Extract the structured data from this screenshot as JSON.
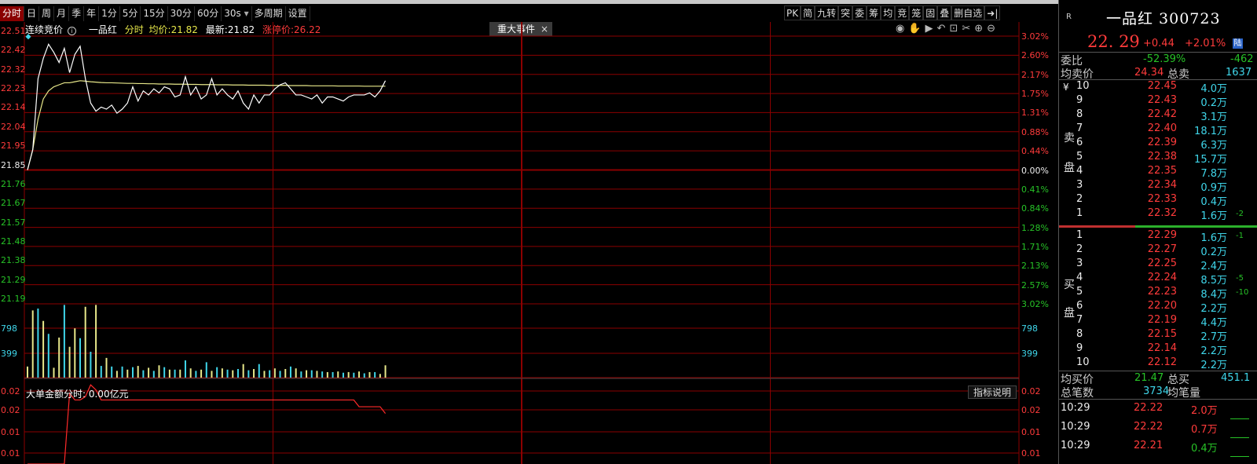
{
  "toolbar": {
    "tabs": [
      "分时",
      "日",
      "周",
      "月",
      "季",
      "年",
      "1分",
      "5分",
      "15分",
      "30分",
      "60分",
      "30s",
      "多周期",
      "设置"
    ],
    "right_tools": [
      "PK",
      "简",
      "九转",
      "突",
      "委",
      "筹",
      "均",
      "竞",
      "笼",
      "固",
      "叠",
      "删自选",
      "➜|"
    ]
  },
  "info": {
    "auction": "连续竞价",
    "name": "一品红",
    "mode": "分时",
    "avg_label": "均价:",
    "avg": "21.82",
    "latest_label": "最新:",
    "latest": "21.82",
    "limit_label": "涨停价:",
    "limit": "26.22",
    "event": "重大事件",
    "event_close": "×"
  },
  "colors": {
    "up": "#ff3b3b",
    "down": "#27c227",
    "grid": "#8b0000",
    "price_line": "#ffffff",
    "avg_line": "#e8e88a",
    "vol_up": "#e8e88a",
    "vol_down": "#3fd6ea",
    "big_order": "#ff2a2a"
  },
  "price_axis": {
    "left": [
      "22.51",
      "22.42",
      "22.32",
      "22.23",
      "22.14",
      "22.04",
      "21.95",
      "21.85",
      "21.76",
      "21.67",
      "21.57",
      "21.48",
      "21.38",
      "21.29",
      "21.19"
    ],
    "right": [
      "3.02%",
      "2.60%",
      "2.17%",
      "1.75%",
      "1.31%",
      "0.88%",
      "0.44%",
      "0.00%",
      "0.41%",
      "0.84%",
      "1.28%",
      "1.71%",
      "2.13%",
      "2.57%",
      "3.02%"
    ]
  },
  "volume_axis": {
    "left": [
      "798",
      "399"
    ],
    "right": [
      "798",
      "399"
    ]
  },
  "sub_chart": {
    "title": "大单金额分时: 0.00亿元",
    "button": "指标说明",
    "left": [
      "0.02",
      "0.02",
      "0.01",
      "0.01"
    ],
    "right": [
      "0.02",
      "0.02",
      "0.01",
      "0.01"
    ]
  },
  "chart_data": {
    "type": "line",
    "price_range": [
      21.19,
      22.51
    ],
    "prev_close": 21.85,
    "price": [
      21.85,
      21.95,
      22.3,
      22.4,
      22.47,
      22.43,
      22.38,
      22.45,
      22.33,
      22.42,
      22.46,
      22.3,
      22.18,
      22.14,
      22.16,
      22.15,
      22.17,
      22.13,
      22.15,
      22.18,
      22.26,
      22.19,
      22.24,
      22.22,
      22.25,
      22.23,
      22.26,
      22.25,
      22.21,
      22.22,
      22.31,
      22.22,
      22.26,
      22.2,
      22.22,
      22.3,
      22.22,
      22.25,
      22.22,
      22.2,
      22.24,
      22.18,
      22.15,
      22.22,
      22.18,
      22.22,
      22.22,
      22.25,
      22.27,
      22.28,
      22.25,
      22.22,
      22.22,
      22.21,
      22.2,
      22.22,
      22.18,
      22.21,
      22.21,
      22.2,
      22.19,
      22.21,
      22.22,
      22.22,
      22.22,
      22.23,
      22.21,
      22.24,
      22.29
    ],
    "avg_price": [
      21.85,
      21.95,
      22.1,
      22.2,
      22.24,
      22.26,
      22.27,
      22.28,
      22.28,
      22.285,
      22.29,
      22.288,
      22.285,
      22.283,
      22.281,
      22.28,
      22.28,
      22.279,
      22.278,
      22.277,
      22.277,
      22.276,
      22.276,
      22.275,
      22.275,
      22.274,
      22.274,
      22.274,
      22.273,
      22.273,
      22.273,
      22.272,
      22.272,
      22.271,
      22.271,
      22.271,
      22.27,
      22.27,
      22.27,
      22.269,
      22.269,
      22.269,
      22.268,
      22.268,
      22.268,
      22.268,
      22.267,
      22.267,
      22.267,
      22.267,
      22.266,
      22.266,
      22.266,
      22.266,
      22.265,
      22.265,
      22.265,
      22.265,
      22.265,
      22.264,
      22.264,
      22.264,
      22.264,
      22.264,
      22.263,
      22.263,
      22.263,
      22.263,
      22.263
    ],
    "volume_max": 1197,
    "volume": [
      180,
      1090,
      1120,
      920,
      710,
      160,
      650,
      1180,
      500,
      800,
      640,
      1150,
      420,
      1180,
      190,
      320,
      180,
      110,
      180,
      130,
      170,
      190,
      120,
      160,
      110,
      200,
      170,
      130,
      130,
      130,
      280,
      150,
      110,
      130,
      250,
      110,
      170,
      150,
      130,
      120,
      140,
      220,
      120,
      140,
      220,
      110,
      120,
      150,
      110,
      140,
      180,
      150,
      100,
      120,
      120,
      110,
      100,
      90,
      90,
      100,
      80,
      90,
      80,
      100,
      70,
      90,
      90,
      60,
      200
    ],
    "volume_color": [
      "y",
      "y",
      "c",
      "y",
      "c",
      "y",
      "y",
      "c",
      "y",
      "y",
      "c",
      "y",
      "c",
      "y",
      "c",
      "y",
      "c",
      "y",
      "c",
      "y",
      "c",
      "y",
      "c",
      "y",
      "c",
      "y",
      "c",
      "y",
      "c",
      "y",
      "c",
      "y",
      "c",
      "y",
      "c",
      "y",
      "c",
      "y",
      "c",
      "y",
      "c",
      "y",
      "c",
      "y",
      "c",
      "y",
      "c",
      "y",
      "c",
      "y",
      "c",
      "y",
      "c",
      "y",
      "c",
      "y",
      "c",
      "y",
      "c",
      "y",
      "c",
      "y",
      "c",
      "y",
      "c",
      "y",
      "c",
      "y",
      "y"
    ],
    "big_order_range": [
      0,
      0.024
    ],
    "big_order": [
      0,
      0,
      0,
      0,
      0,
      0,
      0,
      0.0,
      0.021,
      0.019,
      0.019,
      0.02,
      0.0235,
      0.022,
      0.019,
      0.019,
      0.019,
      0.019,
      0.019,
      0.019,
      0.019,
      0.019,
      0.019,
      0.019,
      0.019,
      0.019,
      0.019,
      0.019,
      0.019,
      0.019,
      0.019,
      0.019,
      0.019,
      0.019,
      0.019,
      0.019,
      0.019,
      0.019,
      0.019,
      0.019,
      0.019,
      0.019,
      0.019,
      0.019,
      0.019,
      0.019,
      0.019,
      0.019,
      0.019,
      0.019,
      0.019,
      0.019,
      0.019,
      0.019,
      0.019,
      0.019,
      0.019,
      0.019,
      0.019,
      0.019,
      0.019,
      0.019,
      0.019,
      0.017,
      0.017,
      0.017,
      0.017,
      0.017,
      0.015
    ]
  },
  "quote": {
    "badge": "R",
    "name": "一品红 300723",
    "price": "22. 29",
    "change": "+0.44",
    "pct": "+2.01%",
    "market": "陆",
    "weibi_label": "委比",
    "weibi": "-52.39%",
    "weicha": "-462",
    "avg_sell_label": "均卖价",
    "avg_sell": "24.34",
    "total_sell_label": "总卖",
    "total_sell": "1637",
    "sell_label_1": "卖",
    "sell_label_2": "盘",
    "yen": "¥",
    "sells": [
      {
        "lv": "10",
        "p": "22.45",
        "q": "4.0万",
        "e": ""
      },
      {
        "lv": "9",
        "p": "22.43",
        "q": "0.2万",
        "e": ""
      },
      {
        "lv": "8",
        "p": "22.42",
        "q": "3.1万",
        "e": ""
      },
      {
        "lv": "7",
        "p": "22.40",
        "q": "18.1万",
        "e": ""
      },
      {
        "lv": "6",
        "p": "22.39",
        "q": "6.3万",
        "e": ""
      },
      {
        "lv": "5",
        "p": "22.38",
        "q": "15.7万",
        "e": ""
      },
      {
        "lv": "4",
        "p": "22.35",
        "q": "7.8万",
        "e": ""
      },
      {
        "lv": "3",
        "p": "22.34",
        "q": "0.9万",
        "e": ""
      },
      {
        "lv": "2",
        "p": "22.33",
        "q": "0.4万",
        "e": ""
      },
      {
        "lv": "1",
        "p": "22.32",
        "q": "1.6万",
        "e": "-2"
      }
    ],
    "buy_label_1": "买",
    "buy_label_2": "盘",
    "buys": [
      {
        "lv": "1",
        "p": "22.29",
        "q": "1.6万",
        "e": "-1"
      },
      {
        "lv": "2",
        "p": "22.27",
        "q": "0.2万",
        "e": ""
      },
      {
        "lv": "3",
        "p": "22.25",
        "q": "2.4万",
        "e": ""
      },
      {
        "lv": "4",
        "p": "22.24",
        "q": "8.5万",
        "e": "-5"
      },
      {
        "lv": "5",
        "p": "22.23",
        "q": "8.4万",
        "e": "-10"
      },
      {
        "lv": "6",
        "p": "22.20",
        "q": "2.2万",
        "e": ""
      },
      {
        "lv": "7",
        "p": "22.19",
        "q": "4.4万",
        "e": ""
      },
      {
        "lv": "8",
        "p": "22.15",
        "q": "2.7万",
        "e": ""
      },
      {
        "lv": "9",
        "p": "22.14",
        "q": "2.2万",
        "e": ""
      },
      {
        "lv": "10",
        "p": "22.12",
        "q": "2.2万",
        "e": ""
      }
    ],
    "avg_buy_label": "均买价",
    "avg_buy": "21.47",
    "total_buy_label": "总买",
    "total_buy": "451.1",
    "deals_label": "总笔数",
    "deals": "3734",
    "avg_vol_label": "均笔量",
    "ticks": [
      {
        "t": "10:29",
        "p": "22.22",
        "q": "2.0万",
        "c": "red"
      },
      {
        "t": "10:29",
        "p": "22.22",
        "q": "0.7万",
        "c": "red"
      },
      {
        "t": "10:29",
        "p": "22.21",
        "q": "0.4万",
        "c": "green"
      }
    ]
  }
}
